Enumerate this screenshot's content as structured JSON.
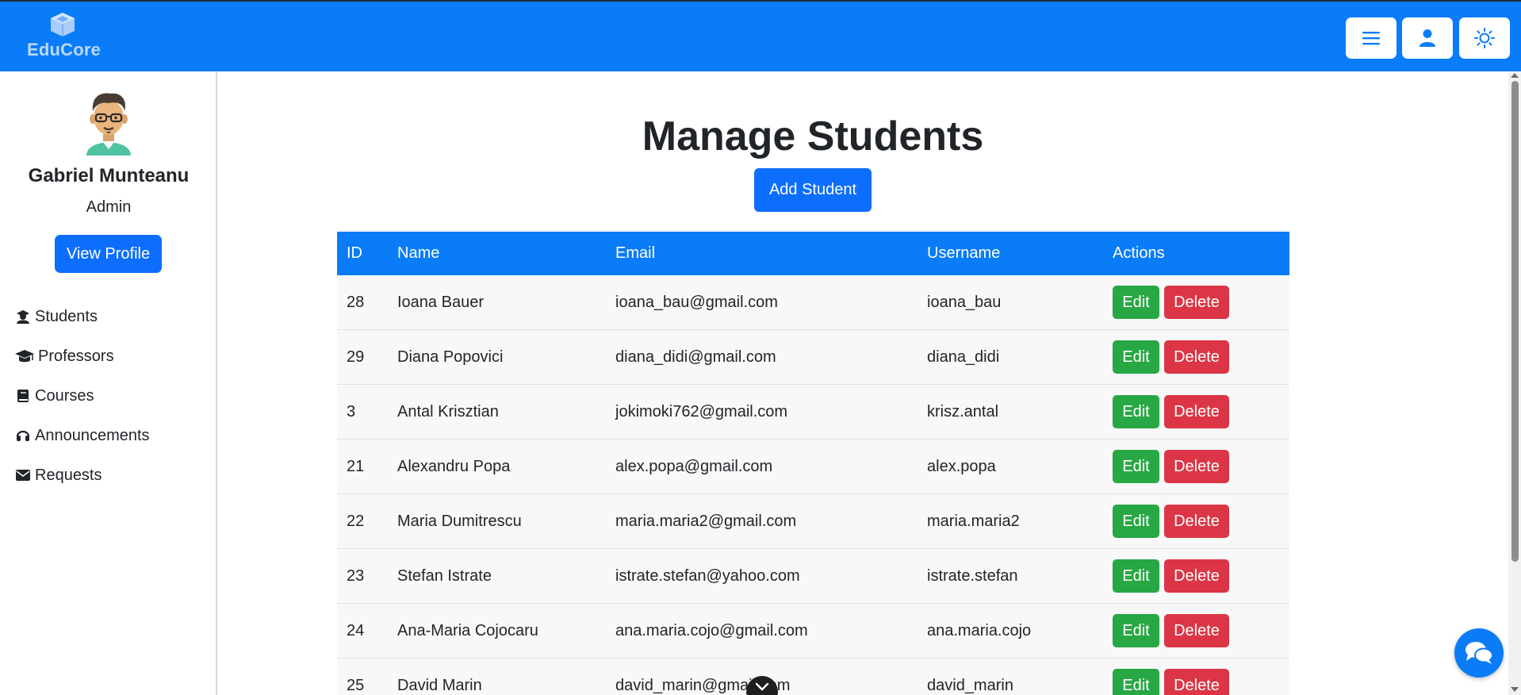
{
  "brand": {
    "name": "EduCore"
  },
  "header": {
    "menu_icon": "hamburger-icon",
    "profile_icon": "user-icon",
    "theme_icon": "sun-icon",
    "accent_color": "#0a7cf7"
  },
  "sidebar": {
    "user": {
      "name": "Gabriel Munteanu",
      "role": "Admin"
    },
    "view_profile_label": "View Profile",
    "items": [
      {
        "label": "Students",
        "icon": "graduate-icon"
      },
      {
        "label": "Professors",
        "icon": "graduation-cap-icon"
      },
      {
        "label": "Courses",
        "icon": "book-icon"
      },
      {
        "label": "Announcements",
        "icon": "headset-icon"
      },
      {
        "label": "Requests",
        "icon": "envelope-icon"
      }
    ]
  },
  "main": {
    "title": "Manage Students",
    "add_button_label": "Add Student",
    "table": {
      "headers": [
        "ID",
        "Name",
        "Email",
        "Username",
        "Actions"
      ],
      "edit_label": "Edit",
      "delete_label": "Delete",
      "rows": [
        {
          "id": "28",
          "name": "Ioana Bauer",
          "email": "ioana_bau@gmail.com",
          "username": "ioana_bau"
        },
        {
          "id": "29",
          "name": "Diana Popovici",
          "email": "diana_didi@gmail.com",
          "username": "diana_didi"
        },
        {
          "id": "3",
          "name": "Antal Krisztian",
          "email": "jokimoki762@gmail.com",
          "username": "krisz.antal"
        },
        {
          "id": "21",
          "name": "Alexandru Popa",
          "email": "alex.popa@gmail.com",
          "username": "alex.popa"
        },
        {
          "id": "22",
          "name": "Maria Dumitrescu",
          "email": "maria.maria2@gmail.com",
          "username": "maria.maria2"
        },
        {
          "id": "23",
          "name": "Stefan Istrate",
          "email": "istrate.stefan@yahoo.com",
          "username": "istrate.stefan"
        },
        {
          "id": "24",
          "name": "Ana-Maria Cojocaru",
          "email": "ana.maria.cojo@gmail.com",
          "username": "ana.maria.cojo"
        },
        {
          "id": "25",
          "name": "David Marin",
          "email": "david_marin@gmail.com",
          "username": "david_marin"
        }
      ]
    }
  },
  "floating": {
    "chat_icon": "chat-bubbles-icon",
    "scroll_icon": "chevron-down-icon"
  },
  "colors": {
    "edit": "#28a745",
    "delete": "#dc3545",
    "primary": "#0d6efd"
  }
}
